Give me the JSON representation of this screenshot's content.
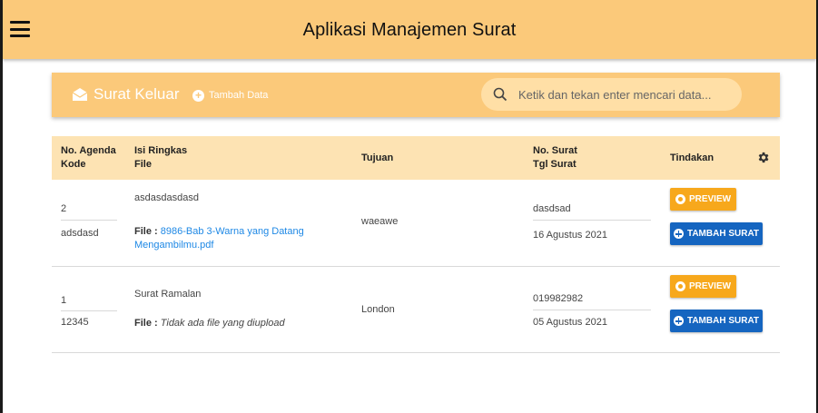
{
  "app": {
    "title": "Aplikasi Manajemen Surat"
  },
  "section": {
    "title": "Surat Keluar",
    "add_label": "Tambah Data",
    "icon": "envelope-open-icon"
  },
  "search": {
    "placeholder": "Ketik dan tekan enter mencari data..."
  },
  "table": {
    "headers": {
      "agenda": "No. Agenda",
      "kode": "Kode",
      "isi": "Isi Ringkas",
      "file": "File",
      "tujuan": "Tujuan",
      "no_surat": "No. Surat",
      "tgl_surat": "Tgl Surat",
      "tindakan": "Tindakan"
    },
    "file_prefix": "File",
    "rows": [
      {
        "agenda": "2",
        "kode": "adsdasd",
        "isi": "asdasdasdasd",
        "file_part1": "8986-Bab 3-Warna yang Datang",
        "file_part2": "Mengambilmu.pdf",
        "tujuan": "waeawe",
        "no_surat": "dasdsad",
        "tgl_surat": "16 Agustus 2021",
        "preview_label": "PREVIEW",
        "add_label": "TAMBAH SURAT"
      },
      {
        "agenda": "1",
        "kode": "12345",
        "isi": "Surat Ramalan",
        "file_none": "Tidak ada file yang diupload",
        "tujuan": "London",
        "no_surat": "019982982",
        "tgl_surat": "05 Agustus 2021",
        "preview_label": "PREVIEW",
        "add_label": "TAMBAH SURAT"
      }
    ]
  },
  "colors": {
    "header": "#fbc97a",
    "preview": "#f7a81c",
    "primary": "#1565c0",
    "link": "#1e88e5"
  }
}
